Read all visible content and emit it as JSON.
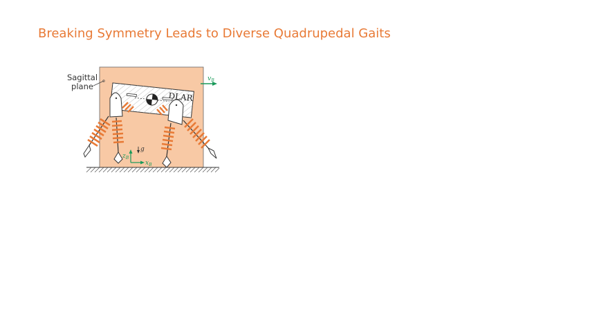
{
  "title": "Breaking Symmetry Leads to Diverse Quadrupedal Gaits",
  "figure": {
    "sagittal_label_1": "Sagittal",
    "sagittal_label_2": "plane",
    "body_label": "DLAR",
    "velocity_label": "v",
    "velocity_sub": "B",
    "gravity_label": "g",
    "z_axis_label": "z",
    "x_axis_label": "x",
    "axis_sub": "B",
    "colors": {
      "plane_fill": "#f8c9a5",
      "spring": "#e87a36",
      "accent_green": "#1a9a5a",
      "title": "#e87a36"
    }
  }
}
